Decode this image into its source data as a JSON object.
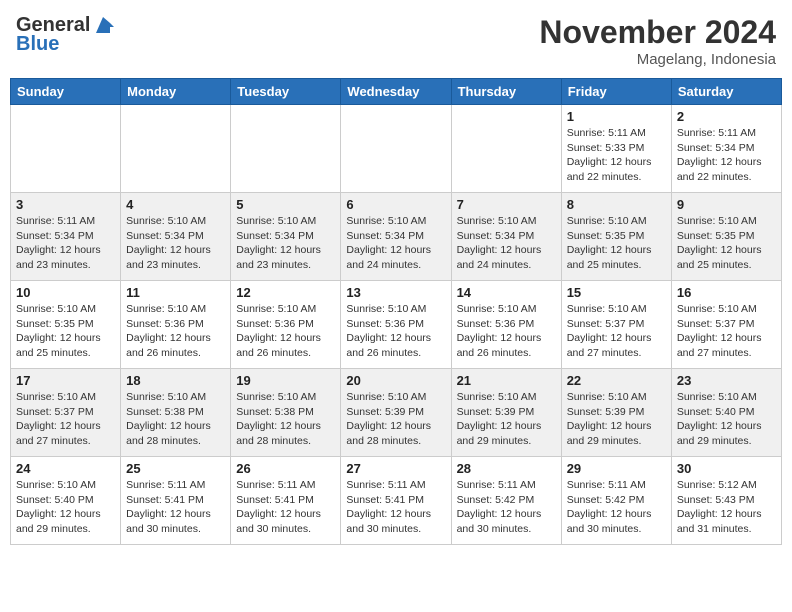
{
  "header": {
    "logo_general": "General",
    "logo_blue": "Blue",
    "month": "November 2024",
    "location": "Magelang, Indonesia"
  },
  "days_of_week": [
    "Sunday",
    "Monday",
    "Tuesday",
    "Wednesday",
    "Thursday",
    "Friday",
    "Saturday"
  ],
  "weeks": [
    [
      {
        "day": "",
        "info": ""
      },
      {
        "day": "",
        "info": ""
      },
      {
        "day": "",
        "info": ""
      },
      {
        "day": "",
        "info": ""
      },
      {
        "day": "",
        "info": ""
      },
      {
        "day": "1",
        "info": "Sunrise: 5:11 AM\nSunset: 5:33 PM\nDaylight: 12 hours\nand 22 minutes."
      },
      {
        "day": "2",
        "info": "Sunrise: 5:11 AM\nSunset: 5:34 PM\nDaylight: 12 hours\nand 22 minutes."
      }
    ],
    [
      {
        "day": "3",
        "info": "Sunrise: 5:11 AM\nSunset: 5:34 PM\nDaylight: 12 hours\nand 23 minutes."
      },
      {
        "day": "4",
        "info": "Sunrise: 5:10 AM\nSunset: 5:34 PM\nDaylight: 12 hours\nand 23 minutes."
      },
      {
        "day": "5",
        "info": "Sunrise: 5:10 AM\nSunset: 5:34 PM\nDaylight: 12 hours\nand 23 minutes."
      },
      {
        "day": "6",
        "info": "Sunrise: 5:10 AM\nSunset: 5:34 PM\nDaylight: 12 hours\nand 24 minutes."
      },
      {
        "day": "7",
        "info": "Sunrise: 5:10 AM\nSunset: 5:34 PM\nDaylight: 12 hours\nand 24 minutes."
      },
      {
        "day": "8",
        "info": "Sunrise: 5:10 AM\nSunset: 5:35 PM\nDaylight: 12 hours\nand 25 minutes."
      },
      {
        "day": "9",
        "info": "Sunrise: 5:10 AM\nSunset: 5:35 PM\nDaylight: 12 hours\nand 25 minutes."
      }
    ],
    [
      {
        "day": "10",
        "info": "Sunrise: 5:10 AM\nSunset: 5:35 PM\nDaylight: 12 hours\nand 25 minutes."
      },
      {
        "day": "11",
        "info": "Sunrise: 5:10 AM\nSunset: 5:36 PM\nDaylight: 12 hours\nand 26 minutes."
      },
      {
        "day": "12",
        "info": "Sunrise: 5:10 AM\nSunset: 5:36 PM\nDaylight: 12 hours\nand 26 minutes."
      },
      {
        "day": "13",
        "info": "Sunrise: 5:10 AM\nSunset: 5:36 PM\nDaylight: 12 hours\nand 26 minutes."
      },
      {
        "day": "14",
        "info": "Sunrise: 5:10 AM\nSunset: 5:36 PM\nDaylight: 12 hours\nand 26 minutes."
      },
      {
        "day": "15",
        "info": "Sunrise: 5:10 AM\nSunset: 5:37 PM\nDaylight: 12 hours\nand 27 minutes."
      },
      {
        "day": "16",
        "info": "Sunrise: 5:10 AM\nSunset: 5:37 PM\nDaylight: 12 hours\nand 27 minutes."
      }
    ],
    [
      {
        "day": "17",
        "info": "Sunrise: 5:10 AM\nSunset: 5:37 PM\nDaylight: 12 hours\nand 27 minutes."
      },
      {
        "day": "18",
        "info": "Sunrise: 5:10 AM\nSunset: 5:38 PM\nDaylight: 12 hours\nand 28 minutes."
      },
      {
        "day": "19",
        "info": "Sunrise: 5:10 AM\nSunset: 5:38 PM\nDaylight: 12 hours\nand 28 minutes."
      },
      {
        "day": "20",
        "info": "Sunrise: 5:10 AM\nSunset: 5:39 PM\nDaylight: 12 hours\nand 28 minutes."
      },
      {
        "day": "21",
        "info": "Sunrise: 5:10 AM\nSunset: 5:39 PM\nDaylight: 12 hours\nand 29 minutes."
      },
      {
        "day": "22",
        "info": "Sunrise: 5:10 AM\nSunset: 5:39 PM\nDaylight: 12 hours\nand 29 minutes."
      },
      {
        "day": "23",
        "info": "Sunrise: 5:10 AM\nSunset: 5:40 PM\nDaylight: 12 hours\nand 29 minutes."
      }
    ],
    [
      {
        "day": "24",
        "info": "Sunrise: 5:10 AM\nSunset: 5:40 PM\nDaylight: 12 hours\nand 29 minutes."
      },
      {
        "day": "25",
        "info": "Sunrise: 5:11 AM\nSunset: 5:41 PM\nDaylight: 12 hours\nand 30 minutes."
      },
      {
        "day": "26",
        "info": "Sunrise: 5:11 AM\nSunset: 5:41 PM\nDaylight: 12 hours\nand 30 minutes."
      },
      {
        "day": "27",
        "info": "Sunrise: 5:11 AM\nSunset: 5:41 PM\nDaylight: 12 hours\nand 30 minutes."
      },
      {
        "day": "28",
        "info": "Sunrise: 5:11 AM\nSunset: 5:42 PM\nDaylight: 12 hours\nand 30 minutes."
      },
      {
        "day": "29",
        "info": "Sunrise: 5:11 AM\nSunset: 5:42 PM\nDaylight: 12 hours\nand 30 minutes."
      },
      {
        "day": "30",
        "info": "Sunrise: 5:12 AM\nSunset: 5:43 PM\nDaylight: 12 hours\nand 31 minutes."
      }
    ]
  ]
}
